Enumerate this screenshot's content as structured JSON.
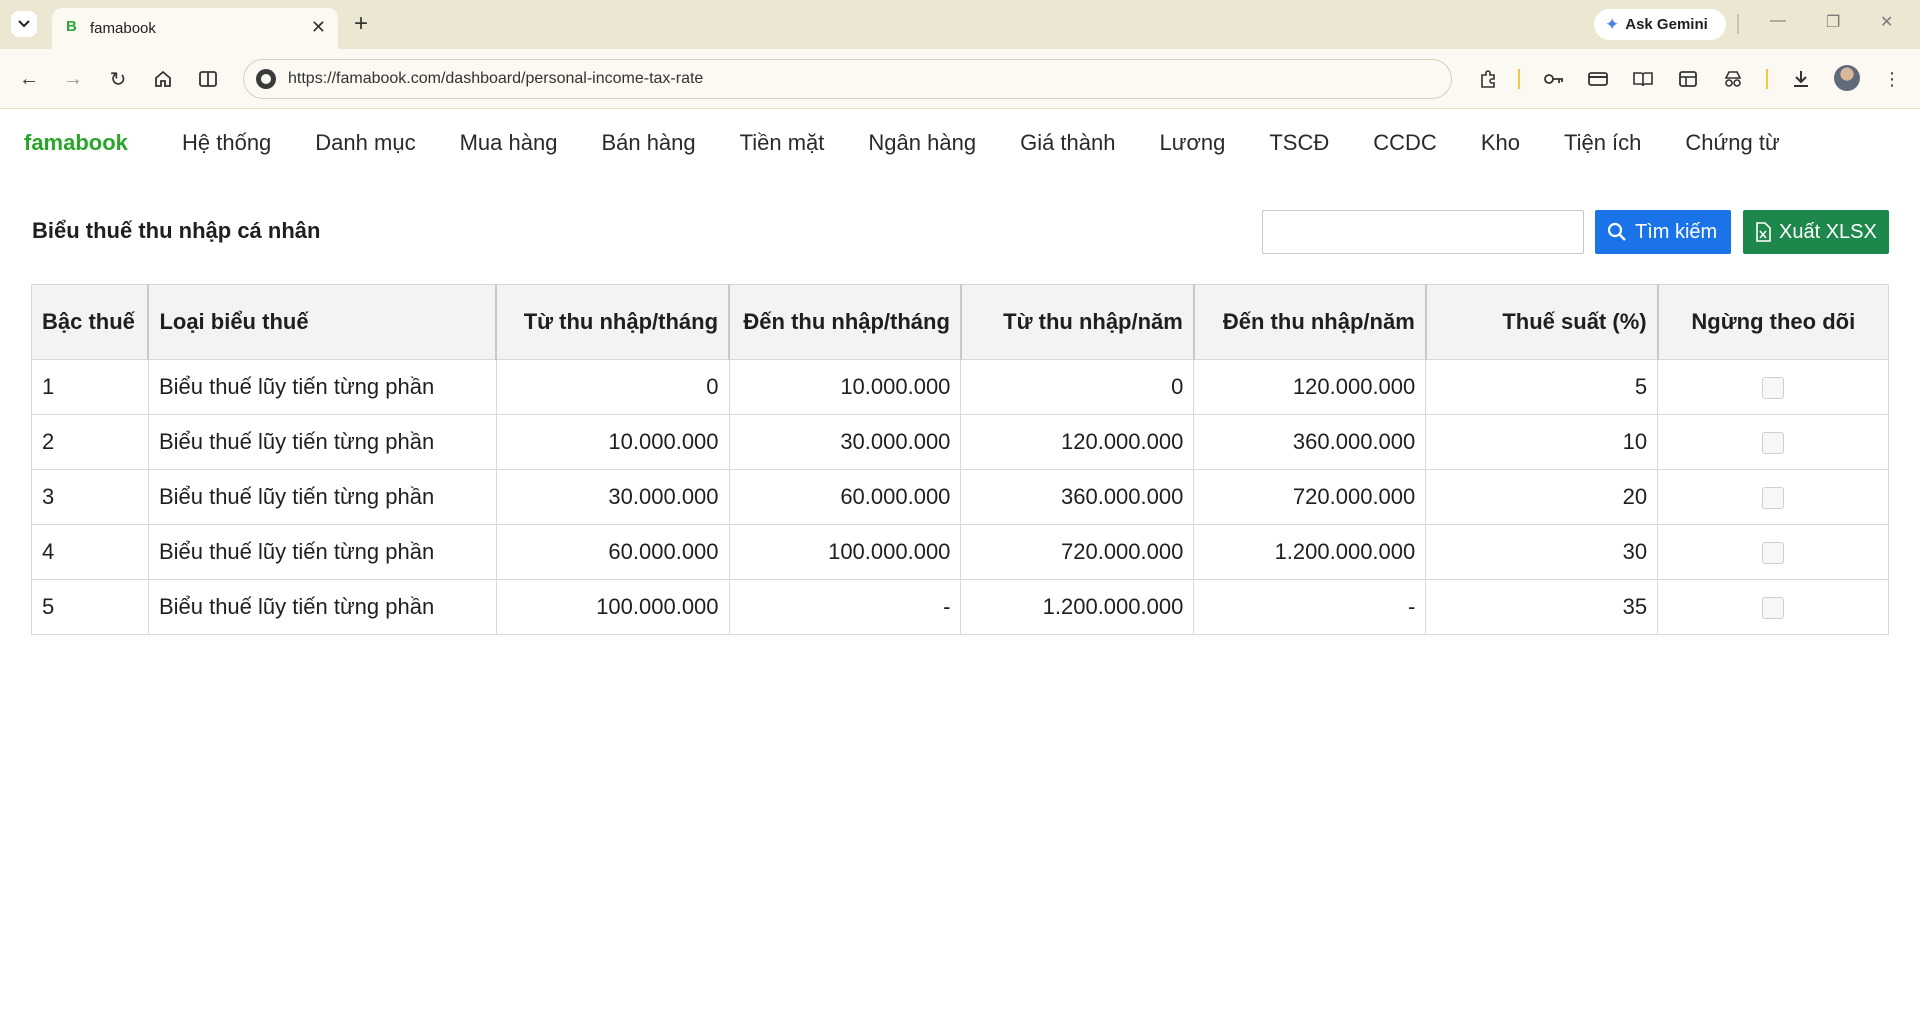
{
  "browser": {
    "tab_title": "famabook",
    "tab_favicon": "B",
    "url": "https://famabook.com/dashboard/personal-income-tax-rate",
    "gemini_label": "Ask Gemini"
  },
  "app": {
    "logo": "famabook",
    "menu": [
      "Hệ thống",
      "Danh mục",
      "Mua hàng",
      "Bán hàng",
      "Tiền mặt",
      "Ngân hàng",
      "Giá thành",
      "Lương",
      "TSCĐ",
      "CCDC",
      "Kho",
      "Tiện ích",
      "Chứng từ"
    ]
  },
  "page": {
    "title": "Biểu thuế thu nhập cá nhân",
    "search_value": "",
    "search_button": "Tìm kiếm",
    "export_button": "Xuất XLSX"
  },
  "table": {
    "headers": [
      "Bậc thuế",
      "Loại biểu thuế",
      "Từ thu nhập/tháng",
      "Đến thu nhập/tháng",
      "Từ thu nhập/năm",
      "Đến thu nhập/năm",
      "Thuế suất (%)",
      "Ngừng theo dõi"
    ],
    "rows": [
      [
        "1",
        "Biểu thuế lũy tiến từng phần",
        "0",
        "10.000.000",
        "0",
        "120.000.000",
        "5"
      ],
      [
        "2",
        "Biểu thuế lũy tiến từng phần",
        "10.000.000",
        "30.000.000",
        "120.000.000",
        "360.000.000",
        "10"
      ],
      [
        "3",
        "Biểu thuế lũy tiến từng phần",
        "30.000.000",
        "60.000.000",
        "360.000.000",
        "720.000.000",
        "20"
      ],
      [
        "4",
        "Biểu thuế lũy tiến từng phần",
        "60.000.000",
        "100.000.000",
        "720.000.000",
        "1.200.000.000",
        "30"
      ],
      [
        "5",
        "Biểu thuế lũy tiến từng phần",
        "100.000.000",
        "-",
        "1.200.000.000",
        "-",
        "35"
      ]
    ],
    "stopped": [
      false,
      false,
      false,
      false,
      false
    ]
  },
  "colors": {
    "brand": "#2aa52a",
    "search_button": "#1a73e8",
    "export_button": "#1e874b"
  }
}
